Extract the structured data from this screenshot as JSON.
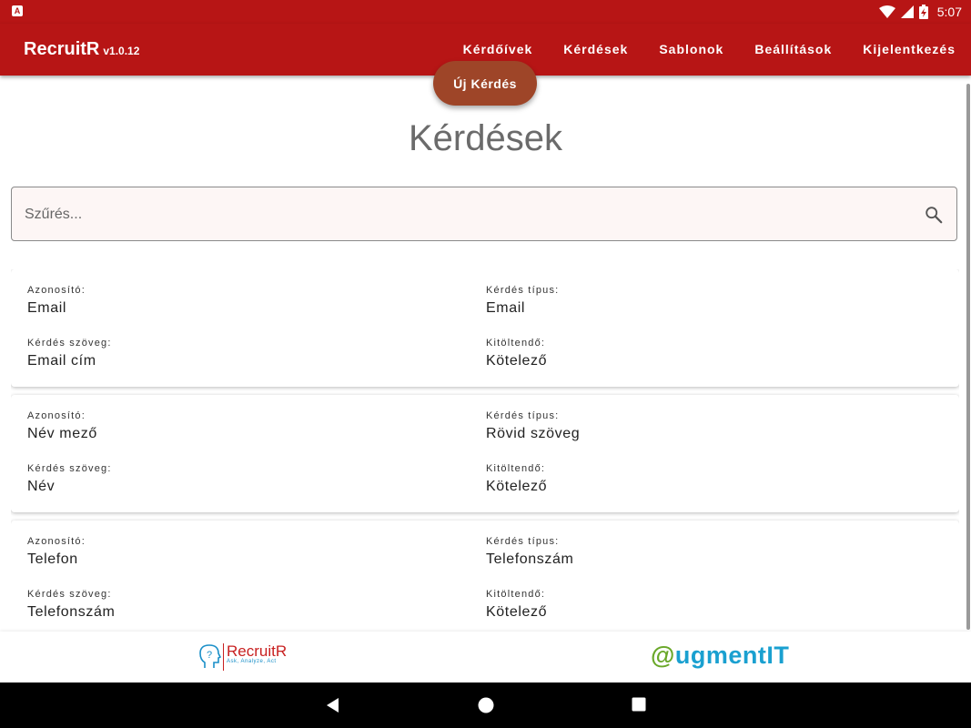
{
  "status_bar": {
    "app_indicator": "A",
    "time": "5:07",
    "icons": [
      "wifi-icon",
      "signal-icon",
      "battery-charging-icon"
    ]
  },
  "app_bar": {
    "title": "RecruitR",
    "version": "v1.0.12",
    "nav": [
      {
        "label": "Kérdőívek"
      },
      {
        "label": "Kérdések"
      },
      {
        "label": "Sablonok"
      },
      {
        "label": "Beállítások"
      },
      {
        "label": "Kijelentkezés"
      }
    ]
  },
  "fab": {
    "label": "Új Kérdés"
  },
  "page_title": "Kérdések",
  "filter": {
    "placeholder": "Szűrés...",
    "value": "",
    "icon": "search-icon"
  },
  "labels": {
    "id": "Azonosító:",
    "type": "Kérdés típus:",
    "text": "Kérdés szöveg:",
    "required": "Kitöltendő:"
  },
  "questions": [
    {
      "id": "Email",
      "type": "Email",
      "text": "Email cím",
      "required": "Kötelező"
    },
    {
      "id": "Név mező",
      "type": "Rövid szöveg",
      "text": "Név",
      "required": "Kötelező"
    },
    {
      "id": "Telefon",
      "type": "Telefonszám",
      "text": "Telefonszám",
      "required": "Kötelező"
    }
  ],
  "footer": {
    "recruitr_logo": {
      "name": "RecruitR",
      "tagline": "Ask, Analyze, Act"
    },
    "augmentit_logo": {
      "at": "@",
      "name": "ugmentIT"
    }
  },
  "colors": {
    "primary": "#b71515",
    "fab": "#9e4528",
    "filter_bg": "#fdf6f5"
  }
}
